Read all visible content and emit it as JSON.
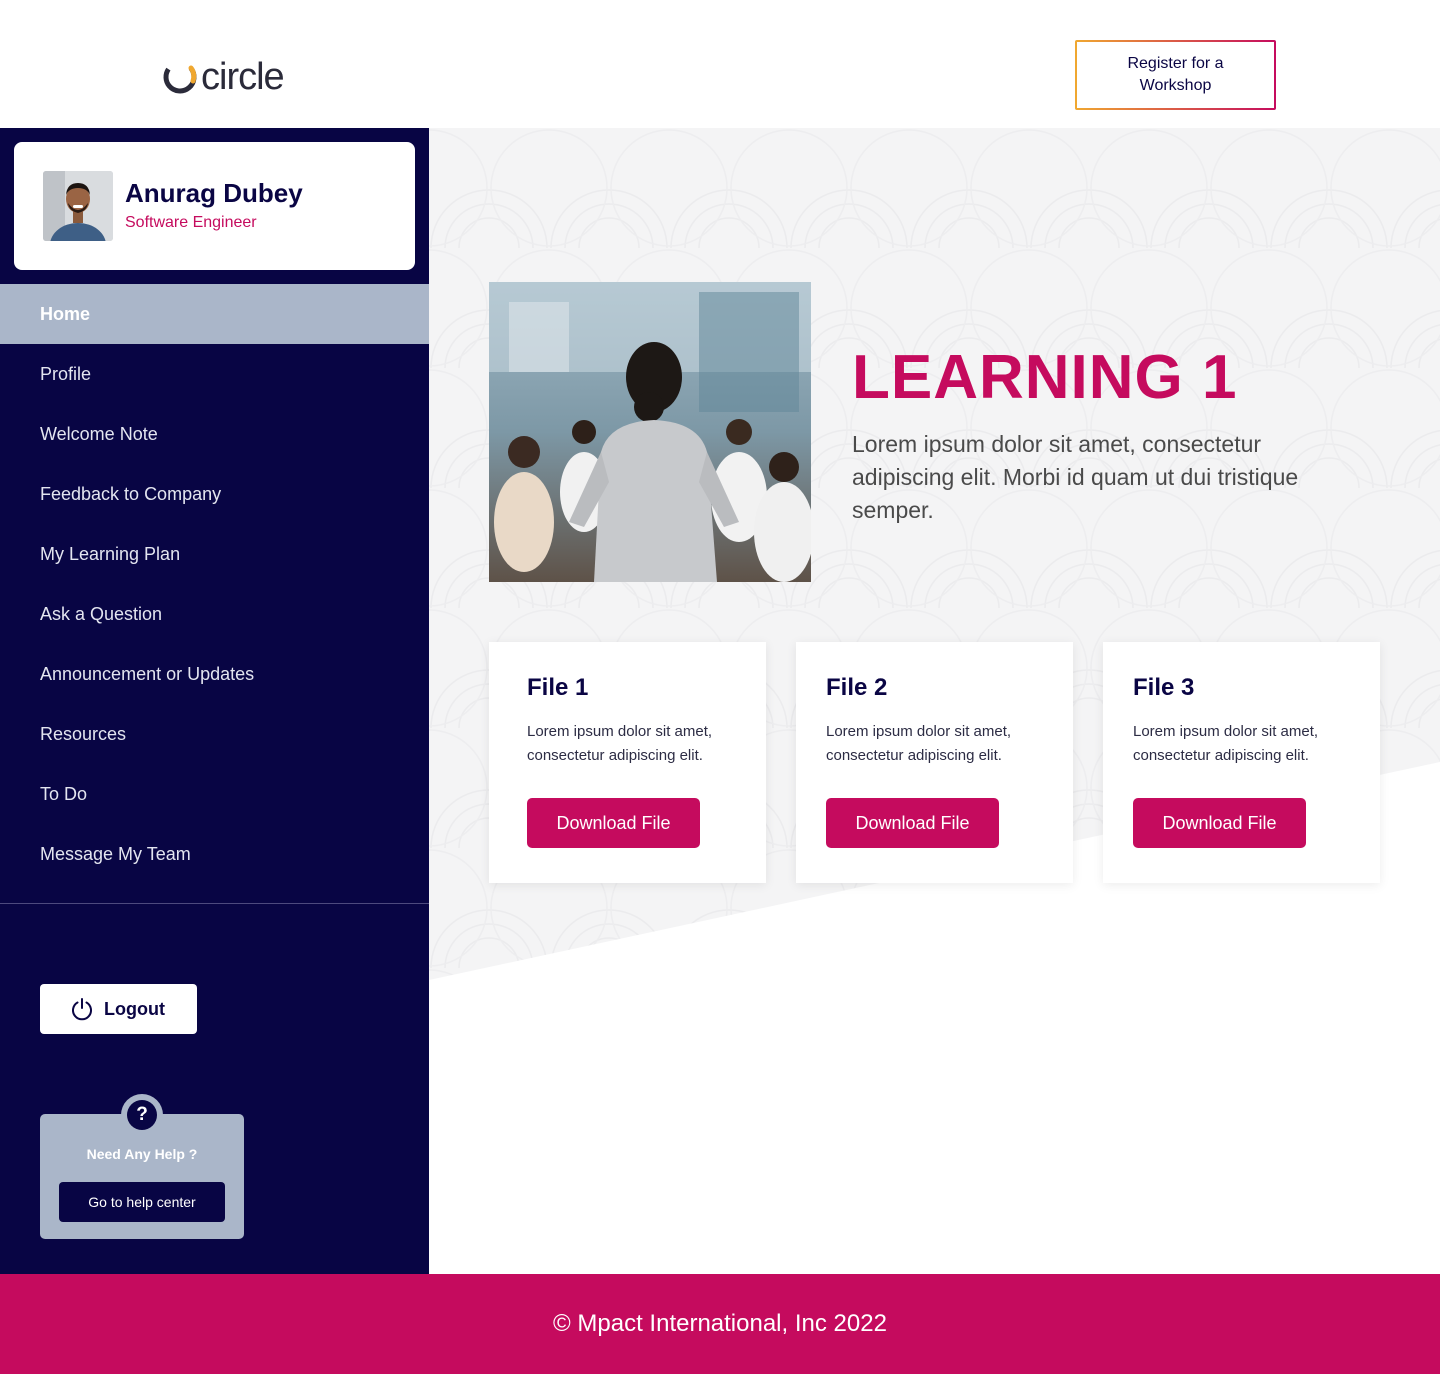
{
  "header": {
    "logo_text": "circle",
    "register_label": "Register for a Workshop"
  },
  "profile": {
    "name": "Anurag Dubey",
    "role": "Software Engineer"
  },
  "sidebar": {
    "items": [
      {
        "label": "Home",
        "active": true
      },
      {
        "label": "Profile"
      },
      {
        "label": "Welcome Note"
      },
      {
        "label": "Feedback to Company"
      },
      {
        "label": "My Learning Plan"
      },
      {
        "label": "Ask a Question"
      },
      {
        "label": "Announcement or Updates"
      },
      {
        "label": "Resources"
      },
      {
        "label": "To Do"
      },
      {
        "label": "Message My Team"
      }
    ],
    "logout_label": "Logout",
    "help": {
      "icon": "?",
      "title": "Need Any Help ?",
      "button_label": "Go to help center"
    }
  },
  "main": {
    "title": "LEARNING 1",
    "description": "Lorem ipsum dolor sit amet, consectetur adipiscing elit. Morbi id quam ut dui tristique semper.",
    "files": [
      {
        "title": "File 1",
        "description": "Lorem ipsum dolor sit amet, consectetur adipiscing elit.",
        "button_label": "Download File"
      },
      {
        "title": "File 2",
        "description": "Lorem ipsum dolor sit amet, consectetur adipiscing elit.",
        "button_label": "Download File"
      },
      {
        "title": "File 3",
        "description": "Lorem ipsum dolor sit amet, consectetur adipiscing elit.",
        "button_label": "Download File"
      }
    ]
  },
  "footer": {
    "text": "© Mpact International, Inc 2022"
  },
  "colors": {
    "navy": "#080544",
    "magenta": "#c50b5e",
    "nav_active": "#aab6c9",
    "accent_orange": "#f0a830"
  }
}
